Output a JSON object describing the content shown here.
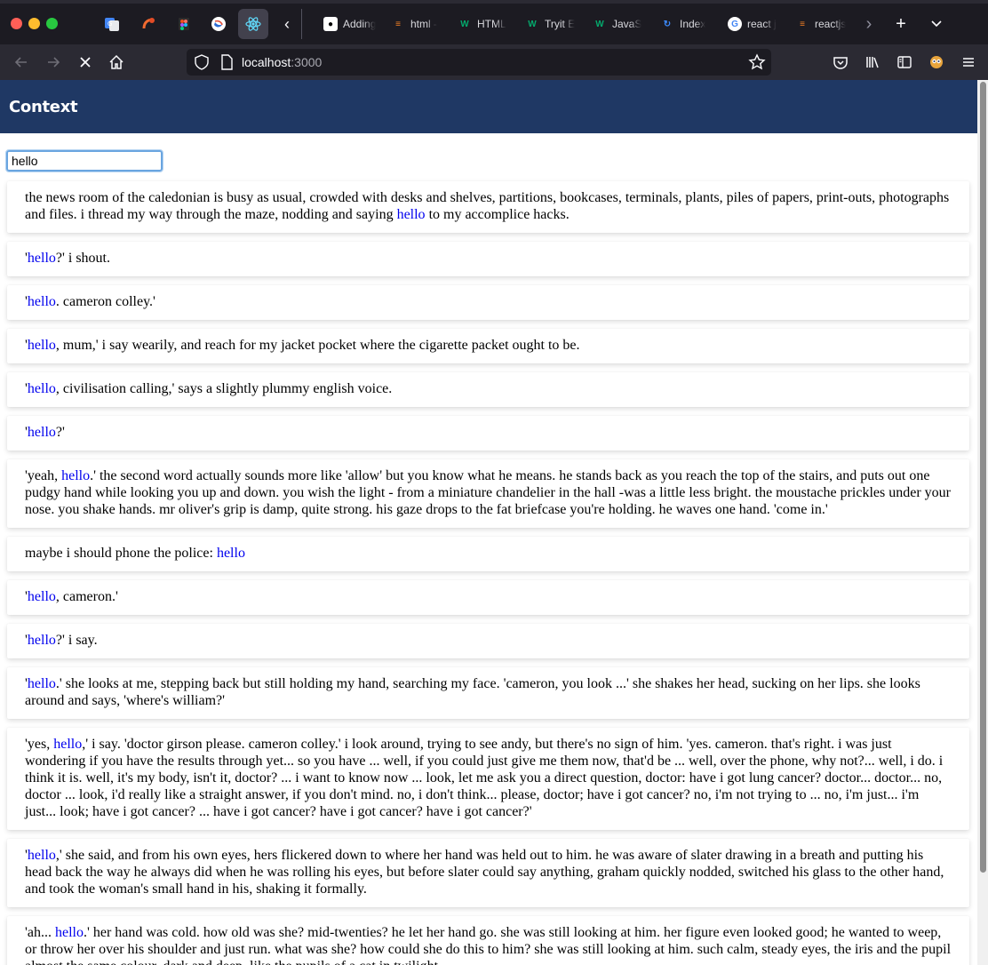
{
  "browser": {
    "pinned_tabs": [
      {
        "icon": "google-translate-icon"
      },
      {
        "icon": "stackshare-icon"
      },
      {
        "icon": "figma-icon"
      },
      {
        "icon": "swift-icon"
      },
      {
        "icon": "react-icon",
        "active": true
      }
    ],
    "tabs": [
      {
        "label": "Adding",
        "icon": "medium-icon"
      },
      {
        "label": "html -",
        "icon": "stackoverflow-icon"
      },
      {
        "label": "HTML",
        "icon": "w3schools-icon"
      },
      {
        "label": "Tryit E",
        "icon": "w3schools-icon"
      },
      {
        "label": "JavaS",
        "icon": "w3schools-icon"
      },
      {
        "label": "Index",
        "icon": "index-icon"
      },
      {
        "label": "react j",
        "icon": "google-icon"
      },
      {
        "label": "reactjs",
        "icon": "stackoverflow-icon"
      }
    ],
    "url_host": "localhost",
    "url_port": ":3000",
    "colors": {
      "tab_strip": "#1c1b22",
      "toolbar": "#2b2a33"
    }
  },
  "app": {
    "title": "Context",
    "header_color": "#1f3864",
    "highlight_color": "#0000ee",
    "search": {
      "value": "hello"
    },
    "results": [
      {
        "before": "the news room of the caledonian is busy as usual, crowded with desks and shelves, partitions, bookcases, terminals, plants, piles of papers, print-outs, photographs and files. i thread my way through the maze, nodding and saying ",
        "match": "hello",
        "after": " to my accomplice hacks."
      },
      {
        "before": "'",
        "match": "hello",
        "after": "?' i shout."
      },
      {
        "before": "'",
        "match": "hello",
        "after": ". cameron colley.'"
      },
      {
        "before": "'",
        "match": "hello",
        "after": ", mum,' i say wearily, and reach for my jacket pocket where the cigarette packet ought to be."
      },
      {
        "before": "'",
        "match": "hello",
        "after": ", civilisation calling,' says a slightly plummy english voice."
      },
      {
        "before": "'",
        "match": "hello",
        "after": "?'"
      },
      {
        "before": "'yeah, ",
        "match": "hello",
        "after": ".' the second word actually sounds more like 'allow' but you know what he means. he stands back as you reach the top of the stairs, and puts out one pudgy hand while looking you up and down. you wish the light - from a miniature chandelier in the hall -was a little less bright. the moustache prickles under your nose. you shake hands. mr oliver's grip is damp, quite strong. his gaze drops to the fat briefcase you're holding. he waves one hand. 'come in.'"
      },
      {
        "before": "maybe i should phone the police: ",
        "match": "hello",
        "after": ""
      },
      {
        "before": "'",
        "match": "hello",
        "after": ", cameron.'"
      },
      {
        "before": "'",
        "match": "hello",
        "after": "?' i say."
      },
      {
        "before": "'",
        "match": "hello",
        "after": ".' she looks at me, stepping back but still holding my hand, searching my face. 'cameron, you look ...' she shakes her head, sucking on her lips. she looks around and says, 'where's william?'"
      },
      {
        "before": "'yes, ",
        "match": "hello",
        "after": ",' i say. 'doctor girson please. cameron colley.' i look around, trying to see andy, but there's no sign of him. 'yes. cameron. that's right. i was just wondering if you have the results through yet... so you have ... well, if you could just give me them now, that'd be ... well, over the phone, why not?... well, i do. i think it is. well, it's my body, isn't it, doctor? ... i want to know now ... look, let me ask you a direct question, doctor: have i got lung cancer? doctor... doctor... no, doctor ... look, i'd really like a straight answer, if you don't mind. no, i don't think... please, doctor; have i got cancer? no, i'm not trying to ... no, i'm just... i'm just... look; have i got cancer? ... have i got cancer? have i got cancer? have i got cancer?'"
      },
      {
        "before": "'",
        "match": "hello",
        "after": ",' she said, and from his own eyes, hers flickered down to where her hand was held out to him. he was aware of slater drawing in a breath and putting his head back the way he always did when he was rolling his eyes, but before slater could say anything, graham quickly nodded, switched his glass to the other hand, and took the woman's small hand in his, shaking it formally."
      },
      {
        "before": "'ah... ",
        "match": "hello",
        "after": ".' her hand was cold. how old was she? mid-twenties? he let her hand go. she was still looking at him. her figure even looked good; he wanted to weep, or throw her over his shoulder and just run. what was she? how could she do this to him? she was still looking at him. such calm, steady eyes, the iris and the pupil almost the same colour, dark and deep, like the pupils of a cat in twilight."
      }
    ]
  }
}
